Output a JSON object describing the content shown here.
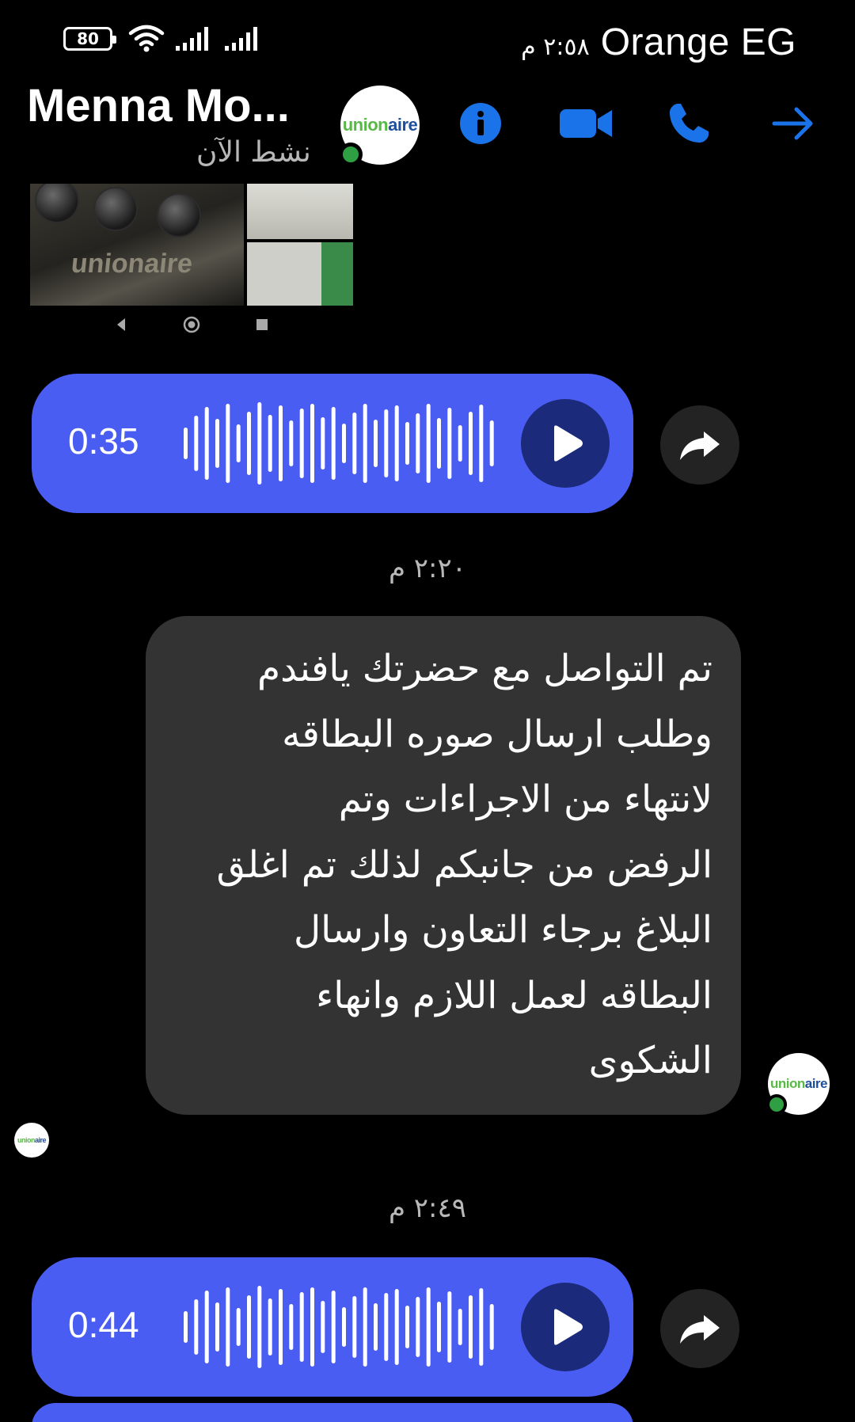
{
  "status_bar": {
    "battery": "80",
    "time": "٢:٥٨ م",
    "carrier": "Orange EG"
  },
  "header": {
    "contact_name": "Menna Mo...",
    "active_status": "نشط الآن",
    "avatar_brand": {
      "part1": "union",
      "part2": "aire"
    },
    "icons": [
      "info-icon",
      "video-call-icon",
      "phone-icon",
      "forward-arrow-icon"
    ],
    "accent_color": "#1a73e8"
  },
  "photo": {
    "logo_text": "unionaire"
  },
  "voice_messages": [
    {
      "duration": "0:35",
      "bubble_color": "#4a5df2"
    },
    {
      "duration": "0:44",
      "bubble_color": "#4a5df2"
    }
  ],
  "timestamps": [
    "٢:٢٠ م",
    "٢:٤٩ م"
  ],
  "text_message": {
    "lines": [
      "تم التواصل مع حضرتك يافندم",
      "وطلب ارسال صوره البطاقه",
      "لانتهاء من الاجراءات وتم",
      "الرفض من جانبكم لذلك تم اغلق",
      "البلاغ برجاء التعاون وارسال",
      "البطاقه لعمل اللازم وانهاء",
      "الشكوى"
    ],
    "bubble_color": "#333333"
  }
}
